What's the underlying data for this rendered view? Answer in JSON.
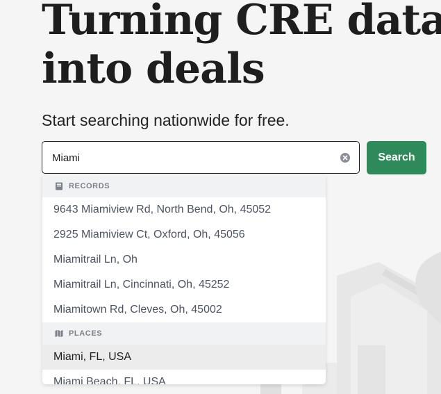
{
  "hero": {
    "title_line1": "Turning CRE data",
    "title_line2": "into deals",
    "subtitle": "Start searching nationwide for free."
  },
  "search": {
    "value": "Miami",
    "button_label": "Search",
    "clear_icon": "clear-circle-icon"
  },
  "dropdown": {
    "records_header": {
      "label": "RECORDS",
      "icon": "book-icon"
    },
    "records": [
      "9643 Miamiview Rd, North Bend, Oh, 45052",
      "2925 Miamiview Ct, Oxford, Oh, 45056",
      "Miamitrail Ln, Oh",
      "Miamitrail Ln, Cincinnati, Oh, 45252",
      "Miamitown Rd, Cleves, Oh, 45002"
    ],
    "places_header": {
      "label": "PLACES",
      "icon": "map-icon"
    },
    "places": [
      "Miami, FL, USA",
      "Miami Beach, FL, USA"
    ]
  },
  "colors": {
    "accent": "#2f8a5b",
    "title": "#1e1e1e",
    "suggestion_text": "#4d5361"
  }
}
